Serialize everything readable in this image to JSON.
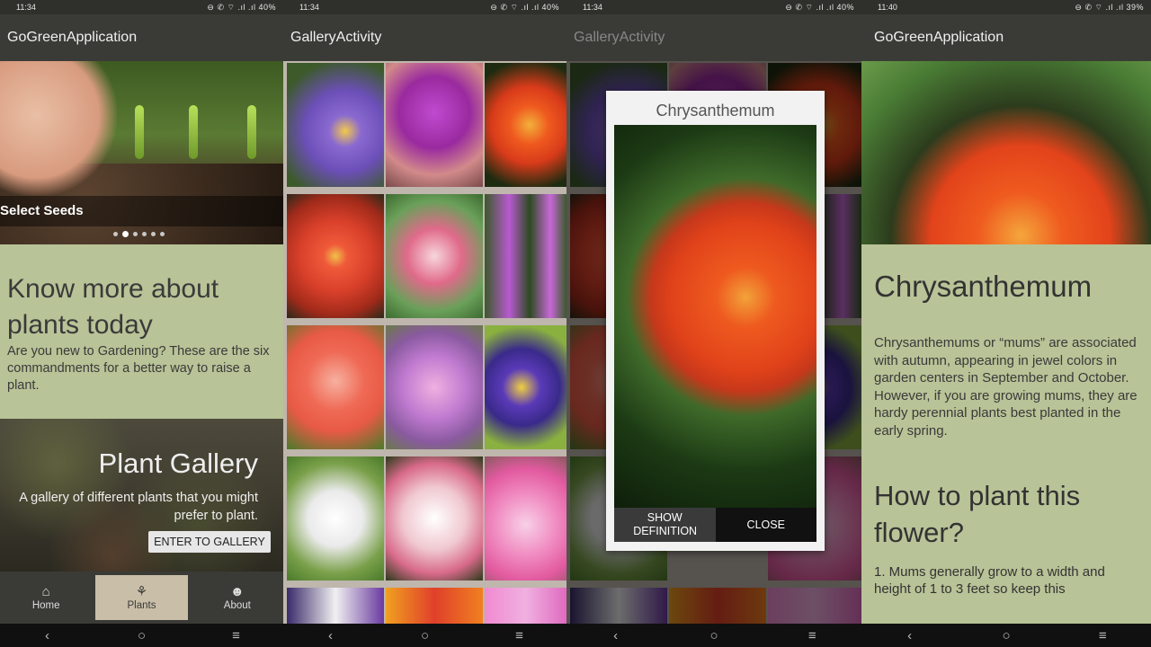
{
  "screen1": {
    "status_time": "11:34",
    "status_icons": "⊖ ✆ ⌔ .ıl .ıl",
    "status_battery": "40%",
    "app_title": "GoGreenApplication",
    "carousel_label": "Select Seeds",
    "info_heading": "Know more about plants today",
    "info_body": "Are you new to Gardening? These are the six commandments for a better way to raise a plant.",
    "gallery_title": "Plant Gallery",
    "gallery_subtitle": "A gallery of different plants that you might prefer to plant.",
    "gallery_button": "ENTER TO GALLERY",
    "nav_home": "Home",
    "nav_plants": "Plants",
    "nav_about": "About"
  },
  "screen2": {
    "status_time": "11:34",
    "status_icons": "⊖ ✆ ⌔ .ıl .ıl",
    "status_battery": "40%",
    "app_title": "GalleryActivity"
  },
  "screen3": {
    "status_time": "11:34",
    "status_icons": "⊖ ✆ ⌔ .ıl .ıl",
    "status_battery": "40%",
    "app_title": "GalleryActivity",
    "dialog_title": "Chrysanthemum",
    "show_definition": "SHOW DEFINITION",
    "close": "CLOSE"
  },
  "screen4": {
    "status_time": "11:40",
    "status_icons": "⊖ ✆ ⌔ .ıl .ıl",
    "status_battery": "39%",
    "app_title": "GoGreenApplication",
    "flower_name": "Chrysanthemum",
    "description": "Chrysanthemums or “mums” are associated with autumn, appearing in jewel colors in garden centers in September and October. However, if you are growing mums, they are hardy perennial plants best planted in the early spring.",
    "how_to_heading": "How to plant this flower?",
    "step1": "1.  Mums generally grow to a width and height of 1 to 3 feet so keep this"
  },
  "nav": {
    "back": "‹",
    "home": "○",
    "menu": "≡"
  },
  "colors": {
    "accent_green": "#b8c397",
    "appbar": "#3a3b36",
    "active_tab": "#c9bea7"
  },
  "icons": {
    "home": "home-icon",
    "plants": "potted-plant-icon",
    "about": "people-icon"
  }
}
